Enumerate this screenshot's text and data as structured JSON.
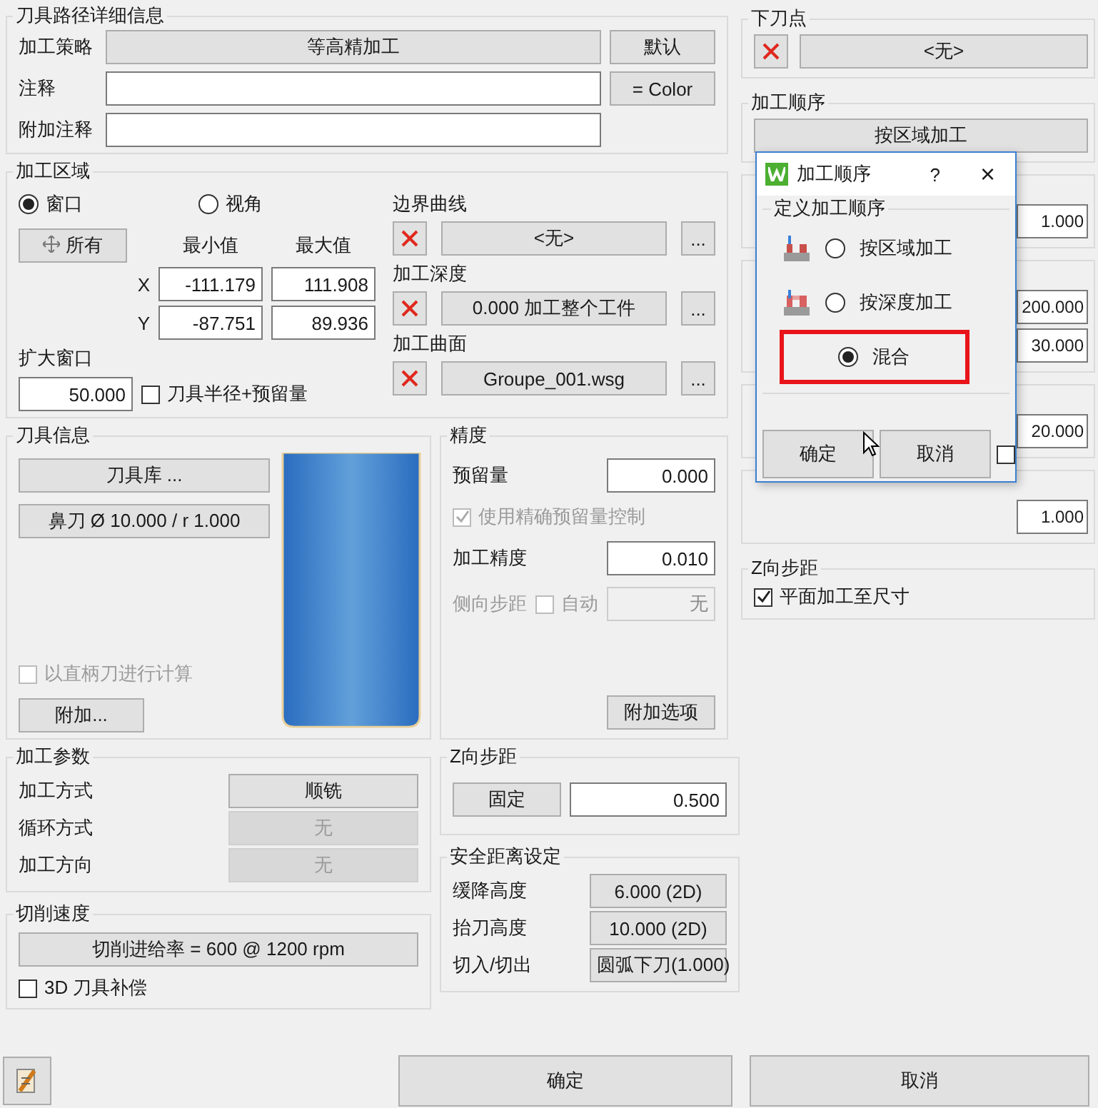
{
  "details": {
    "title": "刀具路径详细信息",
    "strategy_label": "加工策略",
    "strategy": "等高精加工",
    "default_button": "默认",
    "comment_label": "注释",
    "color_button": "= Color",
    "extra_comment_label": "附加注释"
  },
  "area": {
    "title": "加工区域",
    "modes": [
      {
        "label": "窗口",
        "selected": true
      },
      {
        "label": "视角",
        "selected": false
      }
    ],
    "all_button": "所有",
    "min_header": "最小值",
    "max_header": "最大值",
    "rows": [
      {
        "axis": "X",
        "min": "-111.179",
        "max": "111.908"
      },
      {
        "axis": "Y",
        "min": "-87.751",
        "max": "89.936"
      }
    ],
    "expand_label": "扩大窗口",
    "expand_value": "50.000",
    "radius_check": {
      "label": "刀具半径+预留量",
      "checked": false
    },
    "pickers": [
      {
        "label": "边界曲线",
        "value": "<无>",
        "more": "..."
      },
      {
        "label": "加工深度",
        "value": "0.000 加工整个工件",
        "more": "..."
      },
      {
        "label": "加工曲面",
        "value": "Groupe_001.wsg",
        "more": "..."
      }
    ]
  },
  "tool": {
    "title": "刀具信息",
    "library_button": "刀具库 ...",
    "tool_button": "鼻刀 Ø 10.000 / r 1.000",
    "shank_check": {
      "label": "以直柄刀进行计算",
      "checked": false,
      "disabled": true
    },
    "extra_button": "附加..."
  },
  "precision": {
    "title": "精度",
    "stock_label": "预留量",
    "stock": "0.000",
    "exact_check": {
      "label": "使用精确预留量控制",
      "checked": true,
      "disabled": true
    },
    "tolerance_label": "加工精度",
    "tolerance": "0.010",
    "side_step_label": "侧向步距",
    "auto_check": {
      "label": "自动",
      "checked": false,
      "disabled": true
    },
    "side_step": "无",
    "options_button": "附加选项"
  },
  "params": {
    "title": "加工参数",
    "rows": [
      {
        "label": "加工方式",
        "value": "顺铣",
        "disabled": false
      },
      {
        "label": "循环方式",
        "value": "无",
        "disabled": true
      },
      {
        "label": "加工方向",
        "value": "无",
        "disabled": true
      }
    ]
  },
  "speed": {
    "title": "切削速度",
    "button": "切削进给率 = 600 @ 1200 rpm",
    "comp_check": {
      "label": "3D 刀具补偿",
      "checked": false
    }
  },
  "zstep": {
    "title": "Z向步距",
    "mode_button": "固定",
    "value": "0.500"
  },
  "safety": {
    "title": "安全距离设定",
    "rows": [
      {
        "label": "缓降高度",
        "value": "6.000 (2D)"
      },
      {
        "label": "抬刀高度",
        "value": "10.000 (2D)"
      },
      {
        "label": "切入/切出",
        "value": "圆弧下刀(1.000)"
      }
    ]
  },
  "entry_point": {
    "title": "下刀点",
    "value": "<无>"
  },
  "order": {
    "title": "加工顺序",
    "value": "按区域加工"
  },
  "hidden_groups": [
    {
      "values": [
        "1.000"
      ]
    },
    {
      "values": [
        "200.000",
        "30.000"
      ]
    },
    {
      "values": [
        "20.000"
      ]
    },
    {
      "values": [
        "1.000"
      ]
    }
  ],
  "right_zstep": {
    "title": "Z向步距",
    "check": {
      "label": "平面加工至尺寸",
      "checked": true
    }
  },
  "dialog": {
    "title": "加工顺序",
    "help": "?",
    "close": "×",
    "group_title": "定义加工顺序",
    "options": [
      {
        "label": "按区域加工",
        "selected": false,
        "kind": "area",
        "highlighted": false
      },
      {
        "label": "按深度加工",
        "selected": false,
        "kind": "depth",
        "highlighted": false
      },
      {
        "label": "混合",
        "selected": true,
        "kind": "plain",
        "highlighted": true
      }
    ],
    "buttons": [
      "确定",
      "取消"
    ],
    "check": {
      "checked": false
    }
  },
  "footer": {
    "ok": "确定",
    "cancel": "取消"
  }
}
